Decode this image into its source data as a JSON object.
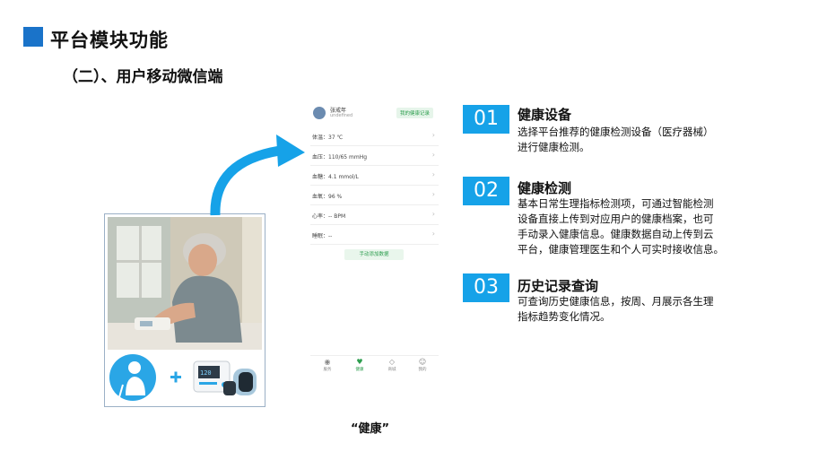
{
  "slide": {
    "title": "平台模块功能",
    "subtitle": "（二）、用户移动微信端",
    "caption": "“健康”",
    "accent": "#1a73c9"
  },
  "phone": {
    "user_name": "张戒年",
    "user_sub": "undefined",
    "record_button": "我的健康记录",
    "rows": [
      {
        "label": "体温：37 ℃"
      },
      {
        "label": "血压：110/65 mmHg"
      },
      {
        "label": "血糖：4.1 mmol/L"
      },
      {
        "label": "血氧：96 %"
      },
      {
        "label": "心率：-- BPM"
      },
      {
        "label": "睡眠：--"
      }
    ],
    "add_button": "手动添加数据",
    "tabs": [
      {
        "label": "服务",
        "icon": "target-icon"
      },
      {
        "label": "健康",
        "icon": "heart-icon"
      },
      {
        "label": "商城",
        "icon": "tag-icon"
      },
      {
        "label": "我的",
        "icon": "user-icon"
      }
    ],
    "accent": "#2e9e4f"
  },
  "features": [
    {
      "num": "01",
      "title": "健康设备",
      "desc": [
        "选择平台推荐的健康检测设备（医疗器械）",
        "进行健康检测。"
      ]
    },
    {
      "num": "02",
      "title": "健康检测",
      "desc": [
        "基本日常生理指标检测项，可通过智能检测",
        "设备直接上传到对应用户的健康档案，也可",
        "手动录入健康信息。健康数据自动上传到云",
        "平台，健康管理医生和个人可实时接收信息。"
      ]
    },
    {
      "num": "03",
      "title": "历史记录查询",
      "desc": [
        "可查询历史健康信息，按周、月展示各生理",
        "指标趋势变化情况。"
      ]
    }
  ],
  "feature_color": "#16a2e8",
  "illustration": {
    "icons": [
      "elderly-person-icon",
      "plus-icon",
      "blood-pressure-monitor-icon",
      "smart-watch-icon"
    ]
  }
}
